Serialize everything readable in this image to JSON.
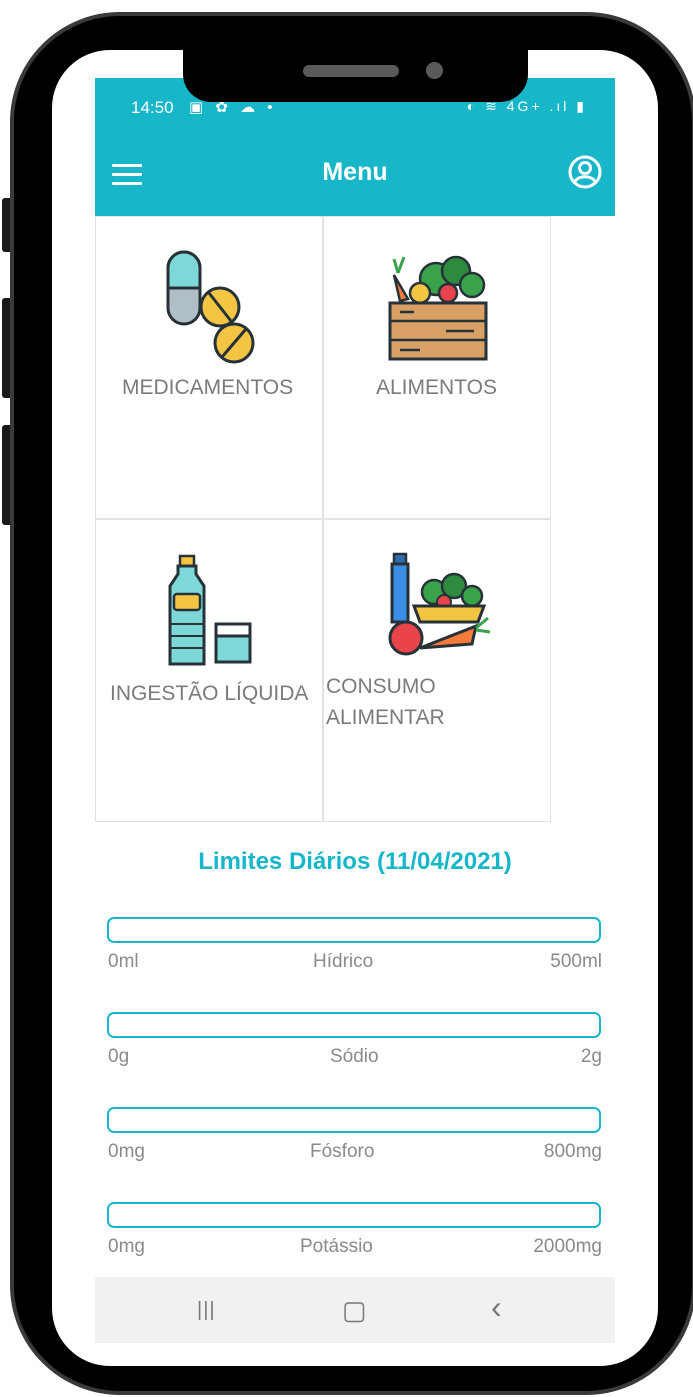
{
  "status_bar": {
    "time": "14:50",
    "left_icons": "▣ ✿ ☁ •",
    "right_icons": "◐ ≋ 4G+ .ıl ▮"
  },
  "header": {
    "title": "Menu",
    "menu_icon": "hamburger-icon",
    "user_icon": "user-circle-icon"
  },
  "menu_items": [
    {
      "label": "MEDICAMENTOS",
      "icon": "pills-icon"
    },
    {
      "label": "ALIMENTOS",
      "icon": "vegetable-crate-icon"
    },
    {
      "label": "INGESTÃO LÍQUIDA",
      "icon": "water-bottle-glass-icon"
    },
    {
      "label_line1": "CONSUMO",
      "label_line2": "ALIMENTAR",
      "icon": "food-consumption-icon"
    }
  ],
  "limits": {
    "title": "Limites Diários (11/04/2021)",
    "items": [
      {
        "name": "Hídrico",
        "min": "0ml",
        "max": "500ml",
        "progress": 0
      },
      {
        "name": "Sódio",
        "min": "0g",
        "max": "2g",
        "progress": 0
      },
      {
        "name": "Fósforo",
        "min": "0mg",
        "max": "800mg",
        "progress": 0
      },
      {
        "name": "Potássio",
        "min": "0mg",
        "max": "2000mg",
        "progress": 0
      }
    ]
  },
  "nav_bar": {
    "recents": "|||",
    "home": "▢",
    "back": "‹"
  },
  "colors": {
    "primary": "#17b6c9",
    "label_gray": "#7b7b7b",
    "frame": "#000000"
  }
}
